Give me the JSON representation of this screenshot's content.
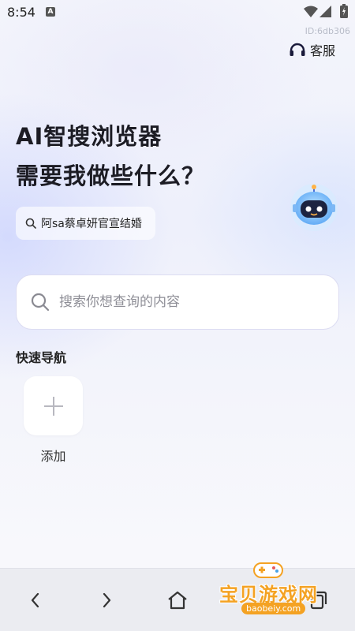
{
  "status_bar": {
    "time": "8:54",
    "notification_icon": "a-letter-icon",
    "icons": [
      "wifi-icon",
      "signal-icon",
      "battery-icon"
    ]
  },
  "header": {
    "id_label": "ID:6db306",
    "service_label": "客服",
    "service_icon": "headset-icon"
  },
  "hero": {
    "title_line1": "AI智搜浏览器",
    "title_line2": "需要我做些什么？",
    "assistant_icon": "robot-assistant-icon"
  },
  "hot_search": {
    "label": "阿sa蔡卓妍官宣结婚",
    "icon": "search-icon"
  },
  "search": {
    "placeholder": "搜索你想查询的内容",
    "value": "",
    "icon": "search-icon"
  },
  "quick_nav": {
    "title": "快速导航",
    "items": [
      {
        "label": "添加",
        "icon": "plus-icon"
      }
    ]
  },
  "bottom_nav": {
    "items": [
      "back-icon",
      "forward-icon",
      "home-icon",
      "tabs-icon"
    ]
  },
  "watermark": {
    "text": "宝贝游戏网",
    "url": "baobeiy.com"
  },
  "colors": {
    "accent": "#4a4aff",
    "watermark": "#f4a223",
    "title": "#1c1c24"
  }
}
